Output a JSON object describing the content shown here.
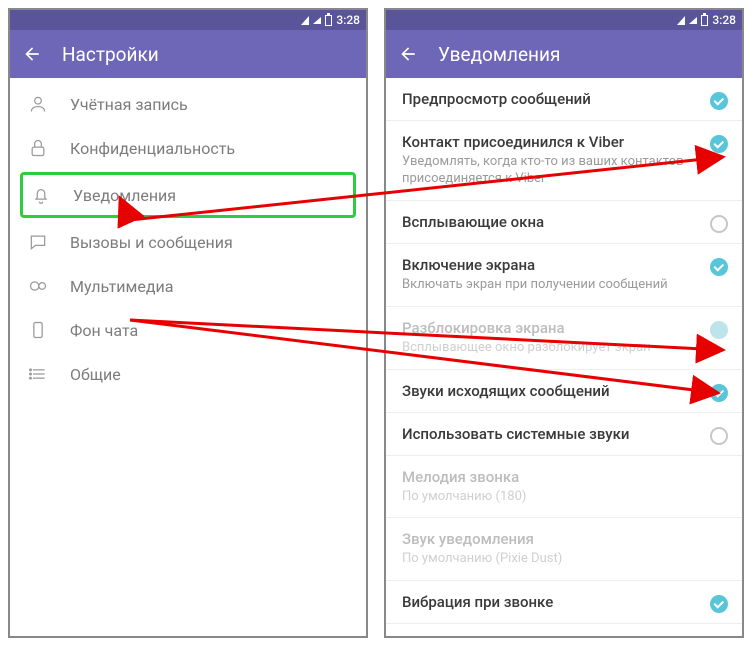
{
  "status": {
    "time": "3:28"
  },
  "screen1": {
    "title": "Настройки",
    "items": [
      {
        "label": "Учётная запись"
      },
      {
        "label": "Конфиденциальность"
      },
      {
        "label": "Уведомления"
      },
      {
        "label": "Вызовы и сообщения"
      },
      {
        "label": "Мультимедиа"
      },
      {
        "label": "Фон чата"
      },
      {
        "label": "Общие"
      }
    ]
  },
  "screen2": {
    "title": "Уведомления",
    "settings": [
      {
        "title": "Предпросмотр сообщений",
        "sub": "",
        "state": "on"
      },
      {
        "title": "Контакт присоединился к Viber",
        "sub": "Уведомлять, когда кто-то из ваших контактов присоединяется к Viber",
        "state": "on"
      },
      {
        "title": "Всплывающие окна",
        "sub": "",
        "state": "off"
      },
      {
        "title": "Включение экрана",
        "sub": "Включать экран при получении сообщений",
        "state": "on"
      },
      {
        "title": "Разблокировка экрана",
        "sub": "Всплывающее окно разблокирует экран",
        "state": "faded"
      },
      {
        "title": "Звуки исходящих сообщений",
        "sub": "",
        "state": "on"
      },
      {
        "title": "Использовать системные звуки",
        "sub": "",
        "state": "off"
      },
      {
        "title": "Мелодия звонка",
        "sub": "По умолчанию (180)",
        "state": ""
      },
      {
        "title": "Звук уведомления",
        "sub": "По умолчанию (Pixie Dust)",
        "state": ""
      },
      {
        "title": "Вибрация при звонке",
        "sub": "",
        "state": "on"
      }
    ]
  }
}
